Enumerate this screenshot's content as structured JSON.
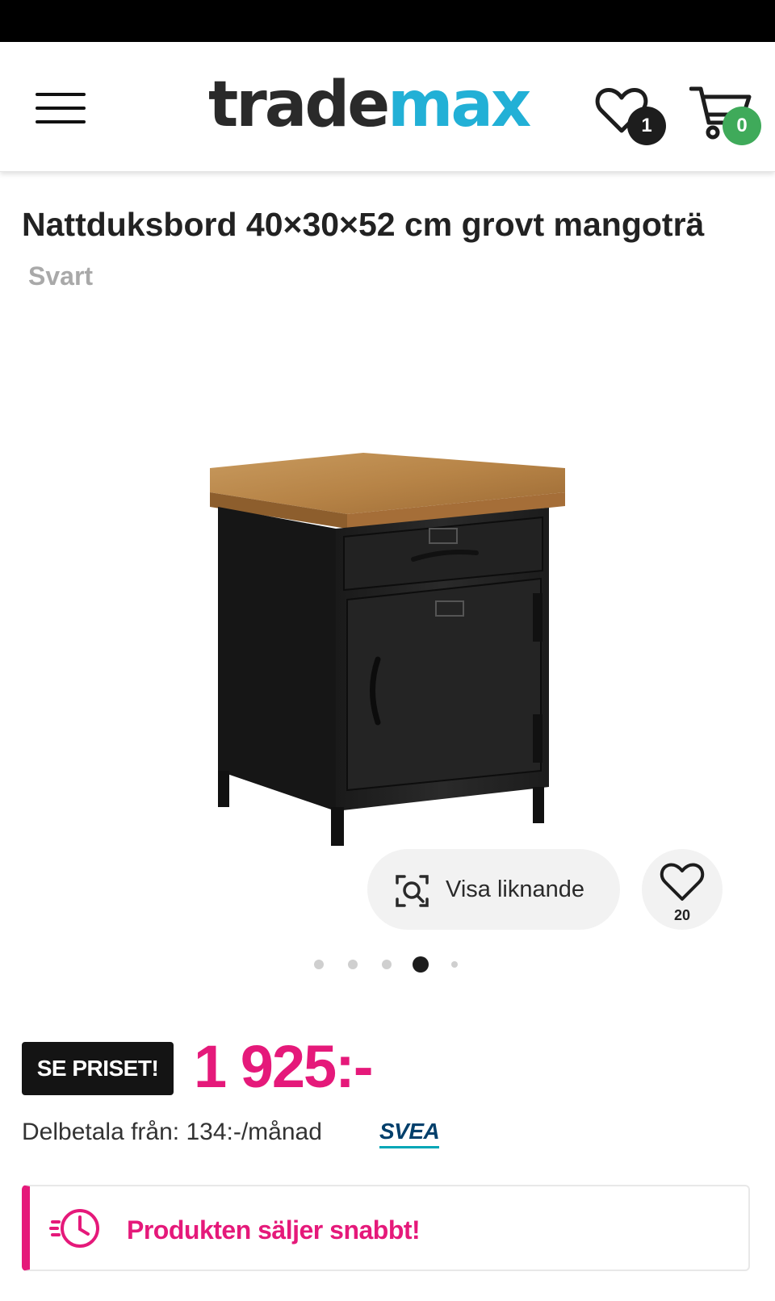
{
  "header": {
    "logo_part1": "trade",
    "logo_part2": "max",
    "wishlist_count": "1",
    "cart_count": "0"
  },
  "product": {
    "title": "Nattduksbord 40×30×52 cm grovt mangoträ",
    "variant": "Svart",
    "similar_label": "Visa liknande",
    "favorite_count": "20",
    "gallery": {
      "image_count": 5,
      "active_index": 3
    }
  },
  "price": {
    "badge_label": "SE PRISET!",
    "amount": "1 925:-",
    "installment_text": "Delbetala från: 134:-/månad",
    "provider": "SVEA"
  },
  "alert": {
    "text": "Produkten säljer snabbt!"
  },
  "colors": {
    "brand_dark": "#2a2a2a",
    "brand_accent": "#22b0d6",
    "price": "#e5197a",
    "cart_badge": "#3faa5a"
  }
}
